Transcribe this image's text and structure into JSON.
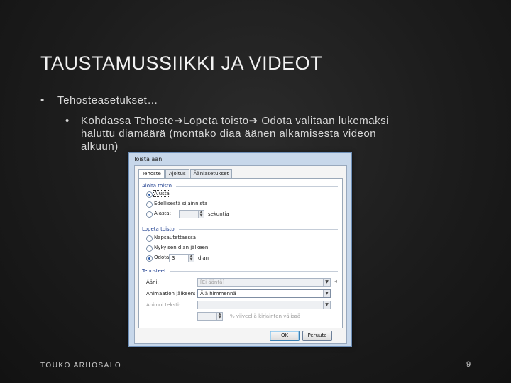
{
  "slide": {
    "title": "TAUSTAMUSSIIKKI JA VIDEOT",
    "bullet1": "Tehosteasetukset…",
    "bullet2": "Kohdassa Tehoste➔Lopeta toisto➔ Odota valitaan lukemaksi haluttu diamäärä (montako diaa äänen alkamisesta videon alkuun)",
    "bullet_glyph": "•",
    "footer": "TOUKO ARHOSALO",
    "page_number": "9"
  },
  "dialog": {
    "title": "Toista ääni",
    "tabs": [
      "Tehoste",
      "Ajoitus",
      "Ääniasetukset"
    ],
    "active_tab": "Tehoste",
    "start_group": {
      "label": "Aloita toisto",
      "options": [
        "Alusta",
        "Edellisestä sijainnista",
        "Ajasta:"
      ],
      "selected": "Alusta",
      "time_unit": "sekuntia"
    },
    "stop_group": {
      "label": "Lopeta toisto",
      "options": [
        "Napsautettaessa",
        "Nykyisen dian jälkeen",
        "Odota:"
      ],
      "selected": "Odota:",
      "value": "3",
      "unit": "dian"
    },
    "effects_group": {
      "label": "Tehosteet",
      "sound_label": "Ääni:",
      "sound_value": "[Ei ääntä]",
      "after_label": "Animaation jälkeen:",
      "after_value": "Älä himmennä",
      "text_label": "Animoi teksti:",
      "text_value": "",
      "delay_label": "% viiveellä kirjainten välissä"
    },
    "ok_label": "OK",
    "cancel_label": "Peruuta"
  },
  "colors": {
    "background": "#1c1c1c",
    "dialog_frame": "#c7d7ea",
    "group_label": "#1f3f8f"
  }
}
